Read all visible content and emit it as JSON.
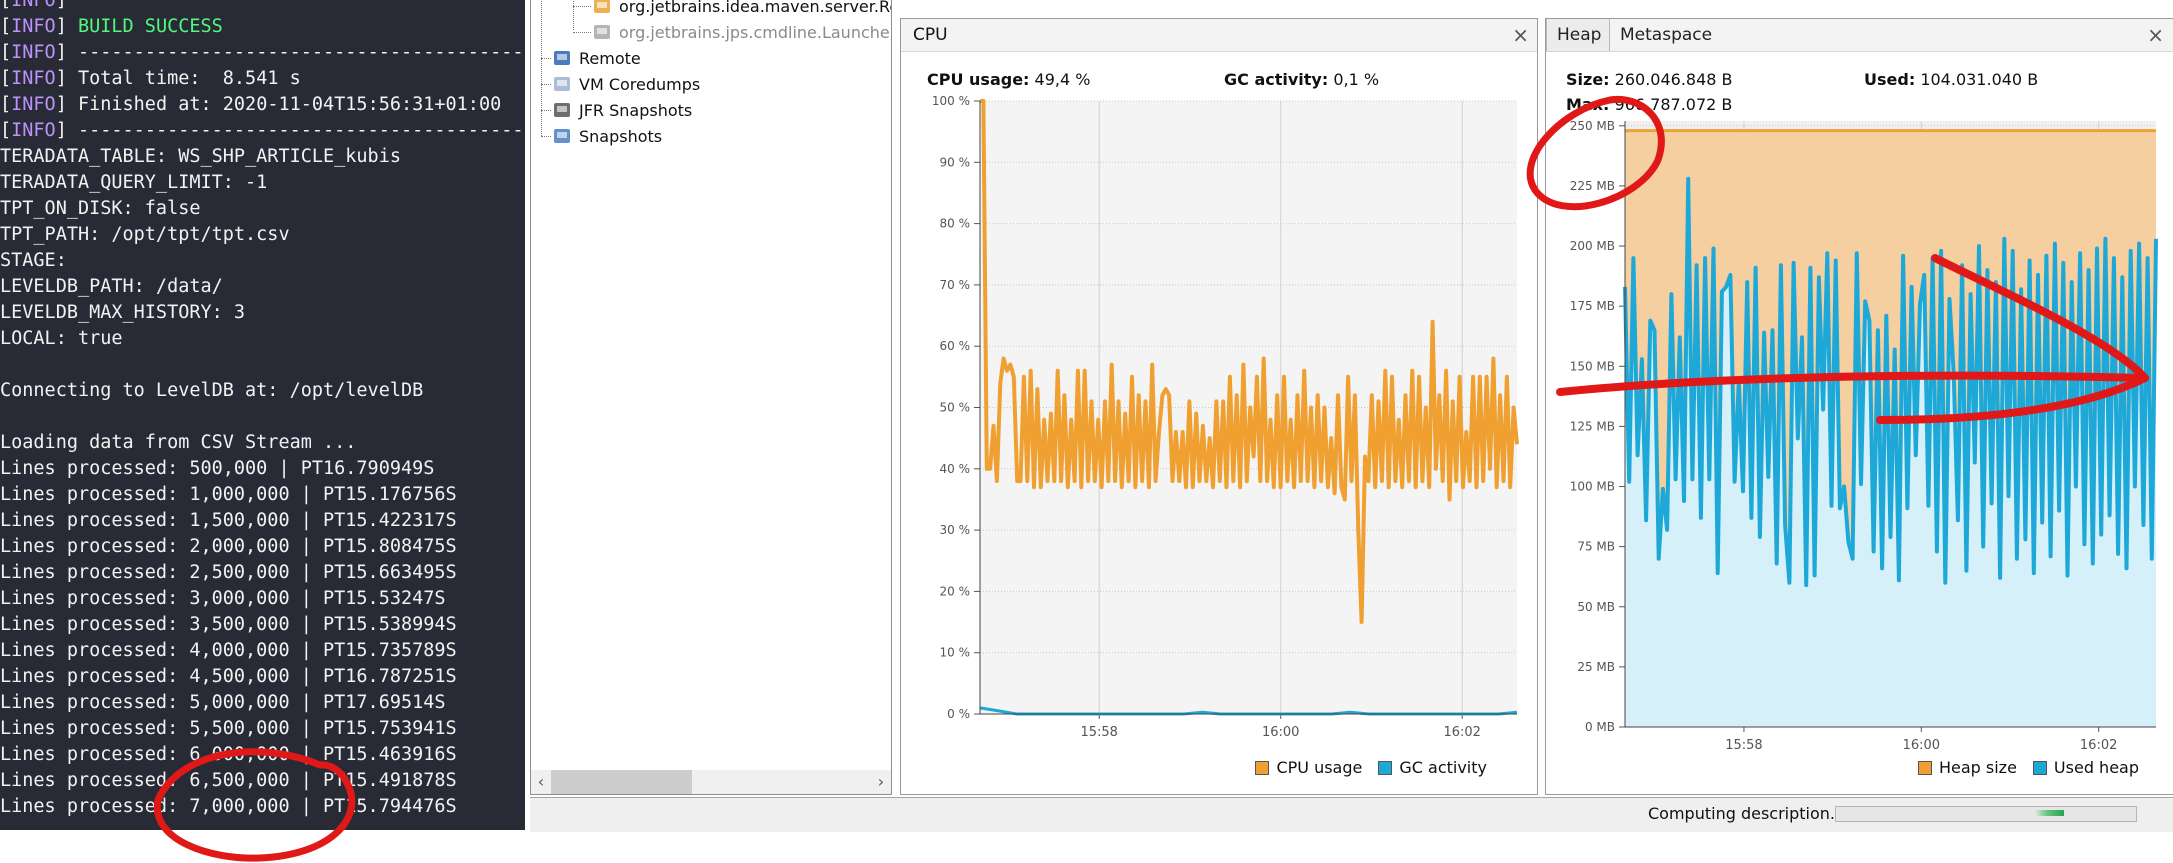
{
  "terminal": {
    "lines": [
      {
        "tag": "INFO",
        "text": ""
      },
      {
        "tag": "INFO",
        "text": "BUILD SUCCESS",
        "style": "success"
      },
      {
        "tag": "INFO",
        "text": "------------------------------------------------------------------------"
      },
      {
        "tag": "INFO",
        "text": "Total time:  8.541 s"
      },
      {
        "tag": "INFO",
        "text": "Finished at: 2020-11-04T15:56:31+01:00"
      },
      {
        "tag": "INFO",
        "text": "------------------------------------------------------------------------"
      },
      {
        "text": "TERADATA_TABLE: WS_SHP_ARTICLE_kubis"
      },
      {
        "text": "TERADATA_QUERY_LIMIT: -1"
      },
      {
        "text": "TPT_ON_DISK: false"
      },
      {
        "text": "TPT_PATH: /opt/tpt/tpt.csv"
      },
      {
        "text": "STAGE:"
      },
      {
        "text": "LEVELDB_PATH: /data/"
      },
      {
        "text": "LEVELDB_MAX_HISTORY: 3"
      },
      {
        "text": "LOCAL: true"
      },
      {
        "text": ""
      },
      {
        "text": "Connecting to LevelDB at: /opt/levelDB"
      },
      {
        "text": ""
      },
      {
        "text": "Loading data from CSV Stream ..."
      },
      {
        "text": "Lines processed: 500,000 | PT16.790949S"
      },
      {
        "text": "Lines processed: 1,000,000 | PT15.176756S"
      },
      {
        "text": "Lines processed: 1,500,000 | PT15.422317S"
      },
      {
        "text": "Lines processed: 2,000,000 | PT15.808475S"
      },
      {
        "text": "Lines processed: 2,500,000 | PT15.663495S"
      },
      {
        "text": "Lines processed: 3,000,000 | PT15.53247S"
      },
      {
        "text": "Lines processed: 3,500,000 | PT15.538994S"
      },
      {
        "text": "Lines processed: 4,000,000 | PT15.735789S"
      },
      {
        "text": "Lines processed: 4,500,000 | PT16.787251S"
      },
      {
        "text": "Lines processed: 5,000,000 | PT17.69514S"
      },
      {
        "text": "Lines processed: 5,500,000 | PT15.753941S"
      },
      {
        "text": "Lines processed: 6,000,000 | PT15.463916S"
      },
      {
        "text": "Lines processed: 6,500,000 | PT15.491878S"
      },
      {
        "text": "Lines processed: 7,000,000 | PT15.794476S"
      }
    ],
    "colors": {
      "background": "#282a36",
      "text": "#f2f2f2",
      "tag": "#bd93f9",
      "success": "#50fa7b"
    }
  },
  "tree": {
    "items": [
      {
        "label": "org.jetbrains.idea.maven.server.RemoteMavenServer",
        "icon": "java-process-icon",
        "dim": false
      },
      {
        "label": "org.jetbrains.jps.cmdline.Launcher (pid)",
        "icon": "java-process-disabled-icon",
        "dim": true
      },
      {
        "label": "Remote",
        "icon": "remote-host-icon",
        "dim": false
      },
      {
        "label": "VM Coredumps",
        "icon": "coredump-icon",
        "dim": false
      },
      {
        "label": "JFR Snapshots",
        "icon": "jfr-snapshot-icon",
        "dim": false
      },
      {
        "label": "Snapshots",
        "icon": "snapshot-icon",
        "dim": false
      }
    ],
    "scroll_left": "‹",
    "scroll_right": "›"
  },
  "cpu_panel": {
    "title": "CPU",
    "close": "×",
    "stats": {
      "cpu_label": "CPU usage:",
      "cpu_value": "49,4 %",
      "gc_label": "GC activity:",
      "gc_value": "0,1 %"
    }
  },
  "heap_panel": {
    "tabs": [
      {
        "label": "Heap",
        "active": true
      },
      {
        "label": "Metaspace",
        "active": false
      }
    ],
    "close": "×",
    "stats": {
      "size_label": "Size:",
      "size_value": "260.046.848 B",
      "used_label": "Used:",
      "used_value": "104.031.040 B",
      "max_label": "Max:",
      "max_value": "966.787.072 B"
    }
  },
  "status_bar": {
    "text": "Computing description...",
    "progress_indeterminate": true
  },
  "chart_data": [
    {
      "type": "line",
      "title": "CPU",
      "xlabel": "",
      "ylabel": "",
      "x_ticks": [
        "15:58",
        "16:00",
        "16:02"
      ],
      "x_range_minutes": [
        15.95,
        16.05
      ],
      "y_ticks": [
        "0 %",
        "10 %",
        "20 %",
        "30 %",
        "40 %",
        "50 %",
        "60 %",
        "70 %",
        "80 %",
        "90 %",
        "100 %"
      ],
      "ylim": [
        0,
        100
      ],
      "grid": true,
      "legend": "bottom-right",
      "series": [
        {
          "name": "CPU usage",
          "color": "#f0a030",
          "summary": "starts at 100%, drops to ~40%, then oscillates between ~37% and ~57% for the rest of the window; one dip to ~15% shortly after 16:00; occasional spikes to ~64%",
          "values": [
            100,
            100,
            40,
            40,
            47,
            38,
            54,
            58,
            56,
            57,
            55,
            38,
            38,
            55,
            38,
            56,
            37,
            53,
            37,
            48,
            38,
            49,
            38,
            56,
            38,
            52,
            37,
            48,
            38,
            56,
            37,
            56,
            38,
            51,
            38,
            48,
            37,
            51,
            38,
            57,
            38,
            51,
            37,
            49,
            38,
            55,
            37,
            52,
            38,
            51,
            37,
            57,
            38,
            46,
            52,
            53,
            52,
            38,
            46,
            38,
            46,
            37,
            51,
            37,
            49,
            38,
            47,
            38,
            45,
            37,
            51,
            38,
            51,
            37,
            55,
            38,
            52,
            37,
            57,
            38,
            50,
            42,
            55,
            38,
            58,
            38,
            48,
            37,
            52,
            37,
            55,
            38,
            48,
            37,
            52,
            38,
            56,
            38,
            50,
            37,
            52,
            38,
            50,
            37,
            45,
            36,
            52,
            37,
            35,
            55,
            38,
            52,
            30,
            15,
            42,
            38,
            52,
            37,
            51,
            38,
            56,
            37,
            55,
            38,
            48,
            37,
            52,
            38,
            56,
            37,
            55,
            38,
            50,
            37,
            64,
            40,
            52,
            38,
            56,
            35,
            51,
            38,
            55,
            37,
            46,
            38,
            55,
            37,
            55,
            38,
            55,
            40,
            58,
            37,
            52,
            38,
            55,
            37,
            50,
            44
          ]
        },
        {
          "name": "GC activity",
          "color": "#1ea8d8",
          "summary": "near 0% throughout with tiny blips",
          "values": [
            1,
            0.5,
            0,
            0,
            0,
            0,
            0,
            0,
            0,
            0,
            0,
            0,
            0.3,
            0,
            0,
            0,
            0,
            0,
            0,
            0,
            0.3,
            0,
            0,
            0,
            0,
            0,
            0,
            0,
            0,
            0.3
          ]
        }
      ]
    },
    {
      "type": "area",
      "title": "Heap",
      "xlabel": "",
      "ylabel": "",
      "x_ticks": [
        "15:58",
        "16:00",
        "16:02"
      ],
      "y_ticks": [
        "0 MB",
        "25 MB",
        "50 MB",
        "75 MB",
        "100 MB",
        "125 MB",
        "150 MB",
        "175 MB",
        "200 MB",
        "225 MB",
        "250 MB"
      ],
      "ylim": [
        0,
        252
      ],
      "grid": true,
      "legend": "bottom-right",
      "series": [
        {
          "name": "Heap size",
          "color": "#f0a030",
          "fill": "#f5cfa0",
          "summary": "constant ~248 MB",
          "values": [
            248,
            248
          ]
        },
        {
          "name": "Used heap",
          "color": "#1ea8d8",
          "fill": "#d6f0fa",
          "summary": "oscillates between ~60 MB and ~200 MB (one spike to ~228 MB)",
          "values": [
            183,
            102,
            195,
            113,
            153,
            86,
            169,
            165,
            70,
            99,
            82,
            180,
            103,
            162,
            94,
            228,
            103,
            192,
            87,
            195,
            103,
            199,
            64,
            181,
            183,
            188,
            102,
            144,
            98,
            185,
            87,
            191,
            79,
            164,
            104,
            165,
            68,
            192,
            84,
            60,
            193,
            120,
            162,
            59,
            191,
            63,
            187,
            132,
            197,
            92,
            194,
            91,
            100,
            77,
            70,
            197,
            101,
            177,
            169,
            73,
            165,
            66,
            171,
            79,
            157,
            61,
            196,
            91,
            183,
            113,
            176,
            188,
            92,
            195,
            73,
            198,
            60,
            178,
            147,
            86,
            192,
            65,
            180,
            110,
            200,
            75,
            190,
            93,
            185,
            62,
            203,
            96,
            198,
            70,
            182,
            78,
            194,
            64,
            188,
            85,
            196,
            71,
            201,
            90,
            193,
            63,
            185,
            100,
            197,
            76,
            190,
            68,
            199,
            80,
            203,
            88,
            195,
            72,
            187,
            66,
            198,
            100,
            201,
            84,
            195,
            70,
            203
          ]
        }
      ]
    }
  ],
  "annotations": {
    "color": "#e01818",
    "items": [
      "circle-around-max-heap-label",
      "arrow-over-heap-chart",
      "circle-around-7000000-lines"
    ]
  }
}
